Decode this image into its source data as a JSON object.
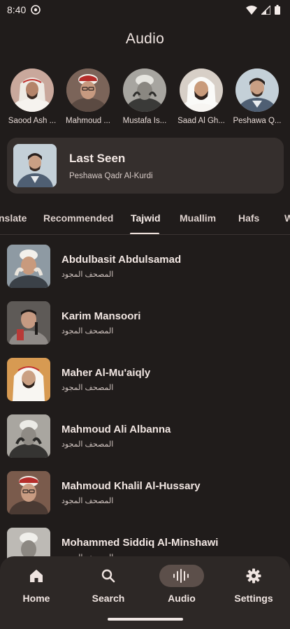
{
  "status": {
    "time": "8:40"
  },
  "header": {
    "title": "Audio"
  },
  "reciters": [
    {
      "name": "Saood Ash ..."
    },
    {
      "name": "Mahmoud ..."
    },
    {
      "name": "Mustafa Is..."
    },
    {
      "name": "Saad Al Gh..."
    },
    {
      "name": "Peshawa Q..."
    }
  ],
  "last_seen": {
    "title": "Last Seen",
    "reciter": "Peshawa Qadr Al-Kurdi"
  },
  "tabs": [
    {
      "label": "nslate"
    },
    {
      "label": "Recommended"
    },
    {
      "label": "Tajwid",
      "active": true
    },
    {
      "label": "Muallim"
    },
    {
      "label": "Hafs"
    },
    {
      "label": "W"
    }
  ],
  "list": [
    {
      "name": "Abdulbasit Abdulsamad",
      "sub": "المصحف المجود"
    },
    {
      "name": "Karim Mansoori",
      "sub": "المصحف المجود"
    },
    {
      "name": "Maher Al-Mu'aiqly",
      "sub": "المصحف المجود"
    },
    {
      "name": "Mahmoud Ali Albanna",
      "sub": "المصحف المجود"
    },
    {
      "name": "Mahmoud Khalil Al-Hussary",
      "sub": "المصحف المجود"
    },
    {
      "name": "Mohammed Siddiq Al-Minshawi",
      "sub": "المصحف المجود"
    }
  ],
  "nav": [
    {
      "label": "Home",
      "icon": "home-icon"
    },
    {
      "label": "Search",
      "icon": "search-icon"
    },
    {
      "label": "Audio",
      "icon": "audio-wave-icon",
      "active": true
    },
    {
      "label": "Settings",
      "icon": "settings-icon"
    }
  ],
  "colors": {
    "background": "#201c1b",
    "card": "#352f2d",
    "nav": "#2d2826",
    "active_pill": "#5c4f4a",
    "text": "#f1e6e2"
  }
}
